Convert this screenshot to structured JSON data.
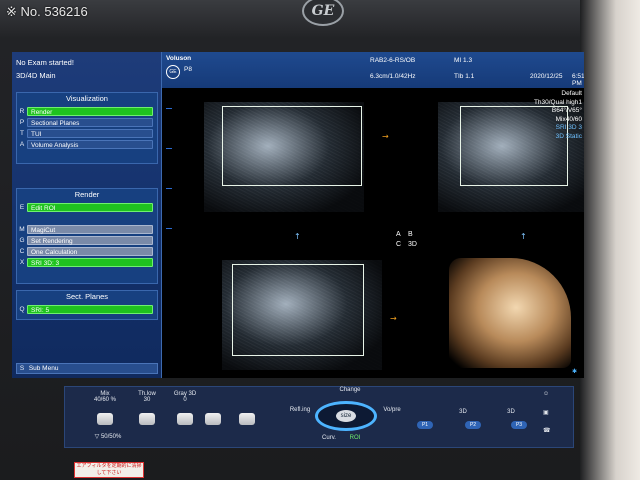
{
  "overlay": {
    "label": "※ No. 536216"
  },
  "logo": {
    "text": "GE"
  },
  "left_panel": {
    "status": "No Exam started!",
    "mode": "3D/4D Main",
    "visualization": {
      "title": "Visualization",
      "items": [
        {
          "key": "R",
          "label": "Render"
        },
        {
          "key": "P",
          "label": "Sectional Planes"
        },
        {
          "key": "T",
          "label": "TUI"
        },
        {
          "key": "A",
          "label": "Volume Analysis"
        }
      ]
    },
    "render": {
      "title": "Render",
      "edit_roi": {
        "key": "E",
        "label": "Edit ROI"
      },
      "items": [
        {
          "key": "M",
          "label": "MagiCut"
        },
        {
          "key": "G",
          "label": "Set Rendering"
        },
        {
          "key": "C",
          "label": "One Calculation"
        },
        {
          "key": "X",
          "label": "SRI 3D: 3"
        }
      ]
    },
    "sect_planes": {
      "title": "Sect. Planes",
      "item": {
        "key": "Q",
        "label": "SRI: 5"
      }
    },
    "sub_menu": {
      "key": "S",
      "label": "Sub Menu"
    }
  },
  "top_bar": {
    "app_name": "Voluson",
    "sub_name": "P8",
    "probe": "RAB2-6-RS/OB",
    "depth_freq": "6.3cm/1.0/42Hz",
    "mi": "MI  1.3",
    "tib": "TIb  1.1",
    "date": "2020/12/25",
    "time": "6:51:55 PM"
  },
  "info": {
    "preset": "Default",
    "line1": "Th30/Qual high1",
    "line2": "B64°/V65°",
    "line3": "Mix40/60",
    "line4": "SRI 3D 3",
    "line5": "3D Static"
  },
  "orientation": {
    "a": "A",
    "b": "B",
    "c": "C",
    "d": "3D"
  },
  "bottom_panel": {
    "mix": "Mix\n40/60 %",
    "th_low": "Th.low\n30",
    "gray3d": "Gray 3D\n0",
    "mix_bottom": "▽ 50/50%",
    "change": "Change",
    "refl": "Refl.ing",
    "vol_pre": "Vo/pre",
    "curv": "Curv.",
    "roi": "ROI",
    "size": "size",
    "p_labels": [
      "P1",
      "P2",
      "P3"
    ],
    "three_d": [
      "3D",
      "3D"
    ]
  },
  "sticker": {
    "text": "エアフィルタを定期的に清掃して下さい"
  },
  "colors": {
    "accent_green": "#1fc21f",
    "panel_blue": "#174080",
    "orange_arrow": "#f0a020"
  }
}
